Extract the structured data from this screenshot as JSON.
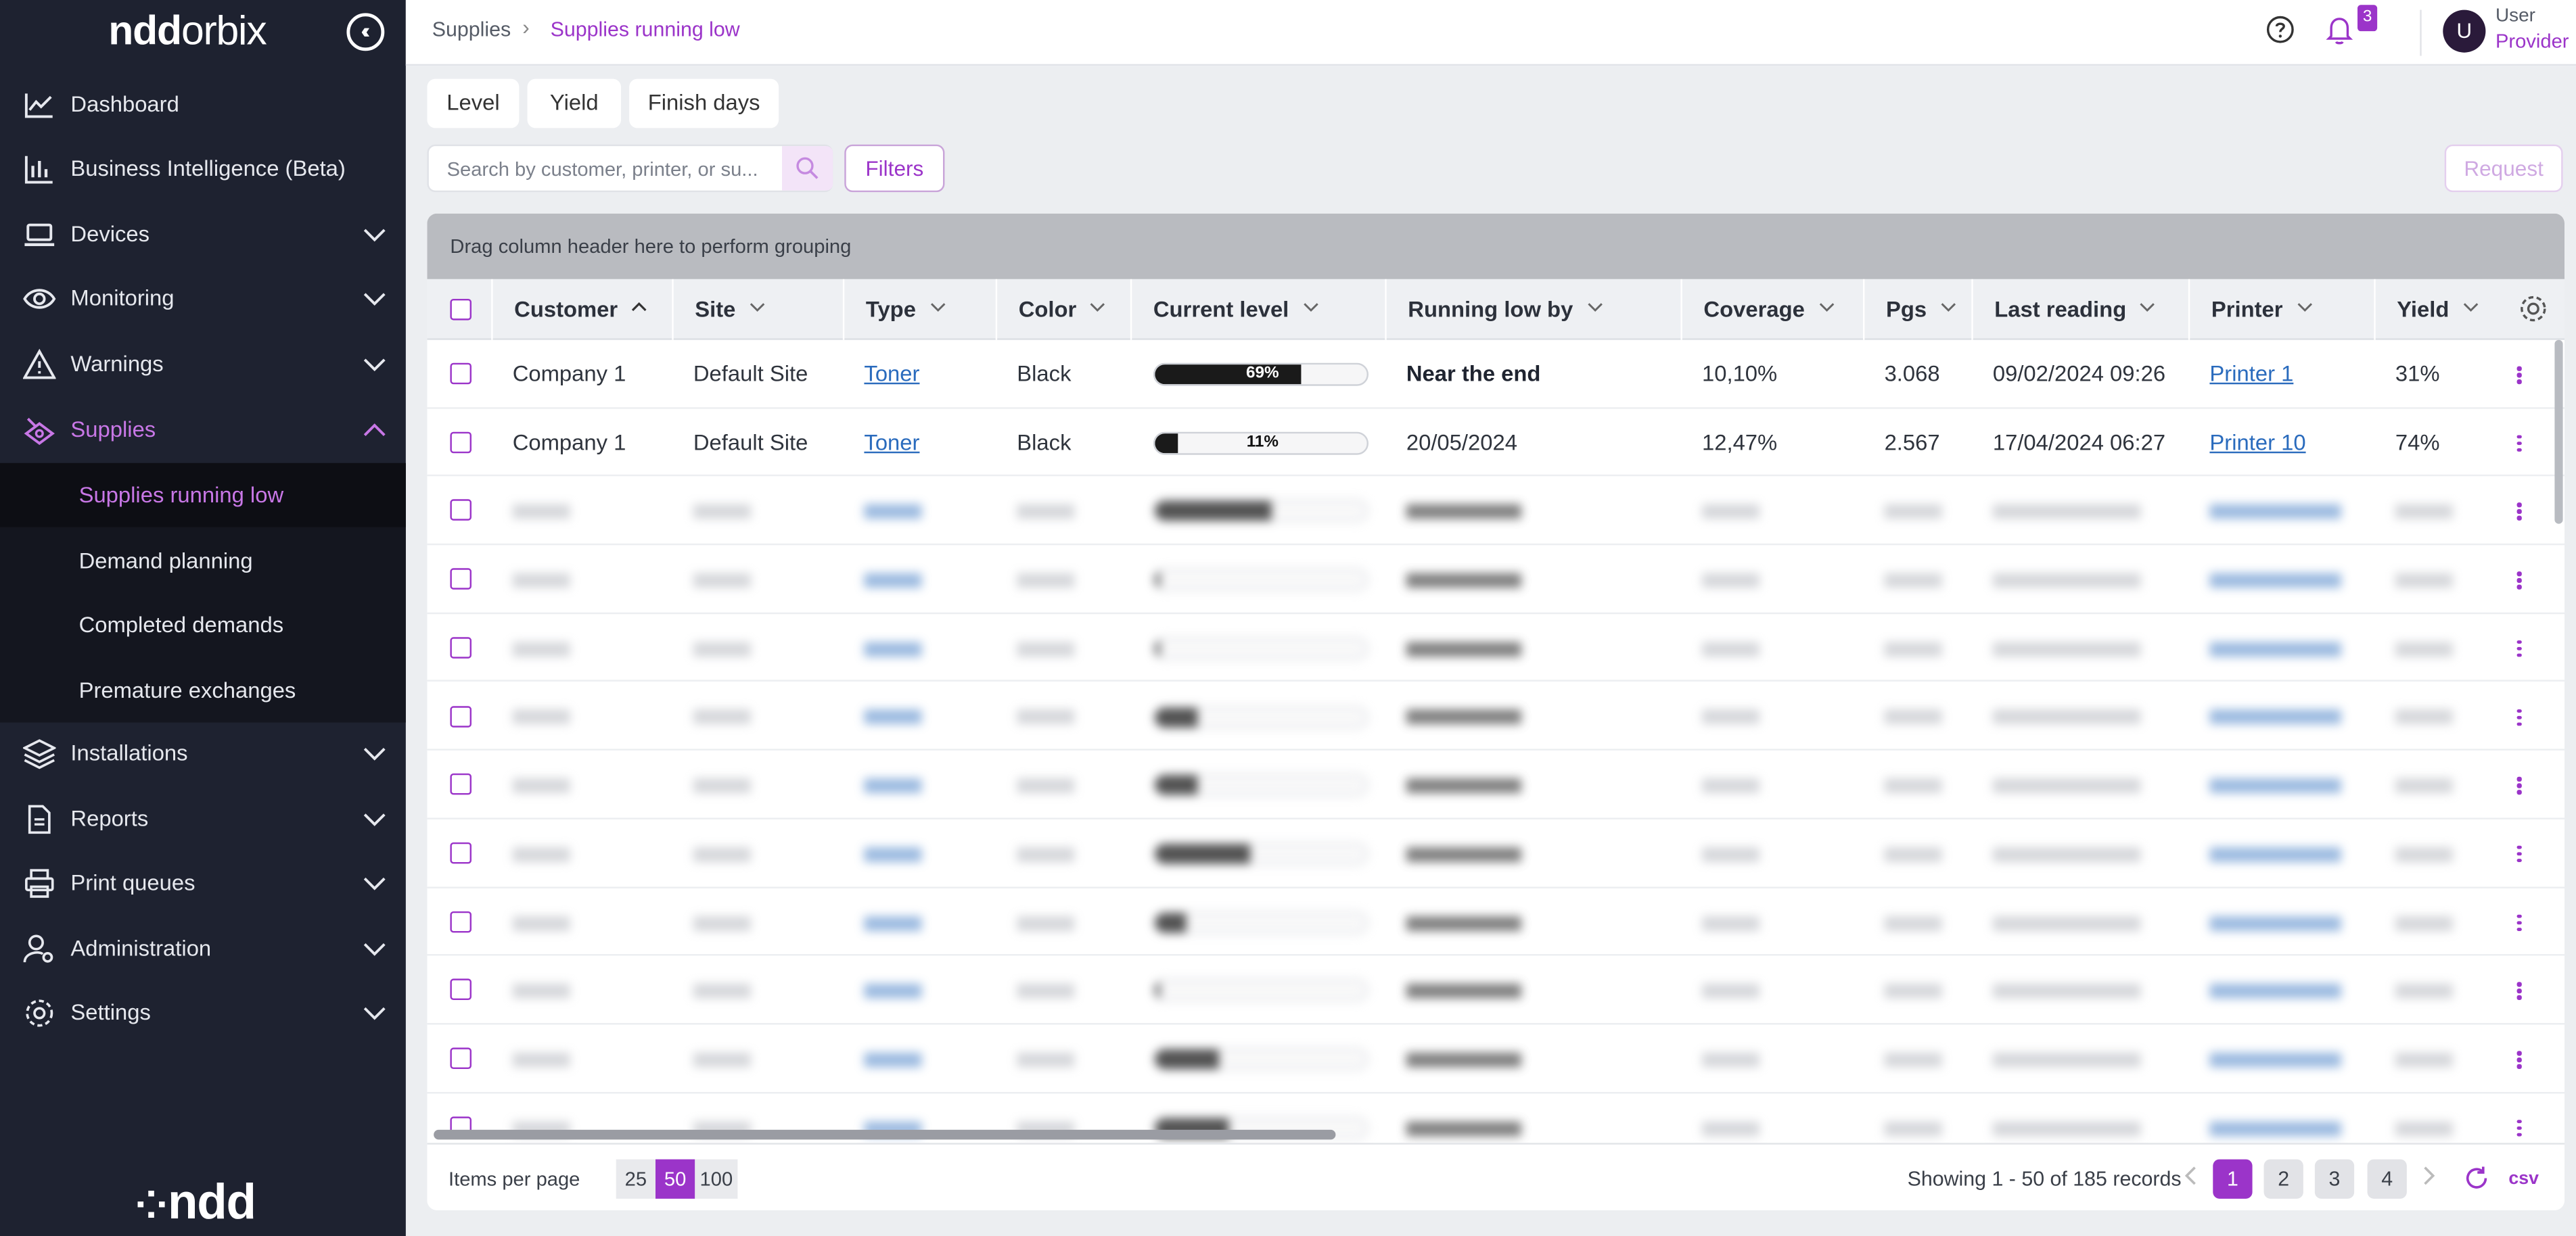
{
  "app": {
    "brand_part1": "ndd",
    "brand_part2": "orbix",
    "footer_logo": "ndd",
    "collapse_icon": "double-chevron-left-icon"
  },
  "sidebar": {
    "items": [
      {
        "label": "Dashboard",
        "icon": "trend-chart-icon"
      },
      {
        "label": "Business Intelligence (Beta)",
        "icon": "bar-chart-icon"
      },
      {
        "label": "Devices",
        "icon": "laptop-icon"
      },
      {
        "label": "Monitoring",
        "icon": "eye-icon"
      },
      {
        "label": "Warnings",
        "icon": "warning-triangle-icon"
      },
      {
        "label": "Supplies",
        "icon": "supplies-icon"
      },
      {
        "label": "Installations",
        "icon": "layers-icon"
      },
      {
        "label": "Reports",
        "icon": "report-icon"
      },
      {
        "label": "Print queues",
        "icon": "printer-icon"
      },
      {
        "label": "Administration",
        "icon": "user-gear-icon"
      },
      {
        "label": "Settings",
        "icon": "gear-icon"
      }
    ],
    "supplies_sub": [
      {
        "label": "Supplies running low"
      },
      {
        "label": "Demand planning"
      },
      {
        "label": "Completed demands"
      },
      {
        "label": "Premature exchanges"
      }
    ]
  },
  "header": {
    "breadcrumb_root": "Supplies",
    "breadcrumb_current": "Supplies running low",
    "notification_count": "3",
    "avatar_initial": "U",
    "user_name": "User",
    "user_role": "Provider"
  },
  "tabs": [
    {
      "label": "Level"
    },
    {
      "label": "Yield"
    },
    {
      "label": "Finish days"
    }
  ],
  "toolbar": {
    "search_placeholder": "Search by customer, printer, or su...",
    "filters_label": "Filters",
    "request_label": "Request"
  },
  "grid": {
    "group_hint": "Drag column header here to perform grouping",
    "columns": [
      {
        "label": "Customer",
        "sort": "asc"
      },
      {
        "label": "Site",
        "sort": "none"
      },
      {
        "label": "Type",
        "sort": "none"
      },
      {
        "label": "Color",
        "sort": "none"
      },
      {
        "label": "Current level",
        "sort": "none"
      },
      {
        "label": "Running low by",
        "sort": "none"
      },
      {
        "label": "Coverage",
        "sort": "none"
      },
      {
        "label": "Pgs",
        "sort": "none"
      },
      {
        "label": "Last reading",
        "sort": "none"
      },
      {
        "label": "Printer",
        "sort": "none"
      },
      {
        "label": "Yield",
        "sort": "none"
      }
    ],
    "rows": [
      {
        "customer": "Company 1",
        "site": "Default Site",
        "type": "Toner",
        "color": "Black",
        "level": 69,
        "level_label": "69%",
        "running_low_by": "Near the end",
        "running_low_bold": true,
        "coverage": "10,10%",
        "pgs": "3.068",
        "last_reading": "09/02/2024 09:26",
        "printer": "Printer 1",
        "yield": "31%"
      },
      {
        "customer": "Company 1",
        "site": "Default Site",
        "type": "Toner",
        "color": "Black",
        "level": 11,
        "level_label": "11%",
        "running_low_by": "20/05/2024",
        "running_low_bold": false,
        "coverage": "12,47%",
        "pgs": "2.567",
        "last_reading": "17/04/2024 06:27",
        "printer": "Printer 10",
        "yield": "74%"
      }
    ]
  },
  "footer": {
    "items_per_page_label": "Items per page",
    "page_sizes": [
      "25",
      "50",
      "100"
    ],
    "active_page_size": "50",
    "showing_text": "Showing  1 - 50 of 185 records",
    "pages": [
      "1",
      "2",
      "3",
      "4"
    ],
    "active_page": "1",
    "csv_label": "csv"
  },
  "colors": {
    "accent": "#9b34c9",
    "sidebar_bg": "#1e2230",
    "sidebar_active": "#c877e6"
  }
}
